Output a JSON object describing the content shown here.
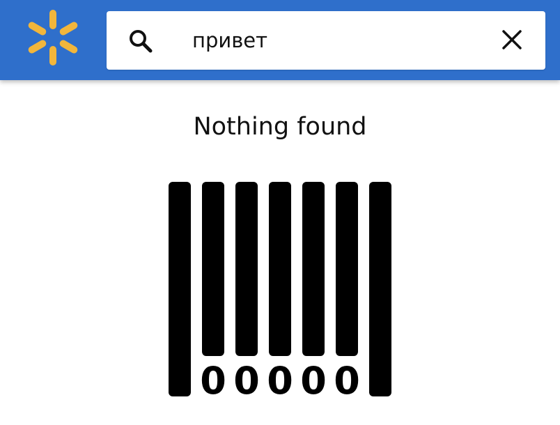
{
  "header": {
    "logo": "walmart-spark-icon",
    "brand_color": "#2f6fcb",
    "logo_color": "#f2b63c"
  },
  "search": {
    "query": "привет",
    "search_icon": "search-icon",
    "clear_icon": "close-icon"
  },
  "results": {
    "message": "Nothing found",
    "illustration": "empty-barcode-icon",
    "barcode_digits": [
      "0",
      "0",
      "0",
      "0",
      "0"
    ]
  }
}
